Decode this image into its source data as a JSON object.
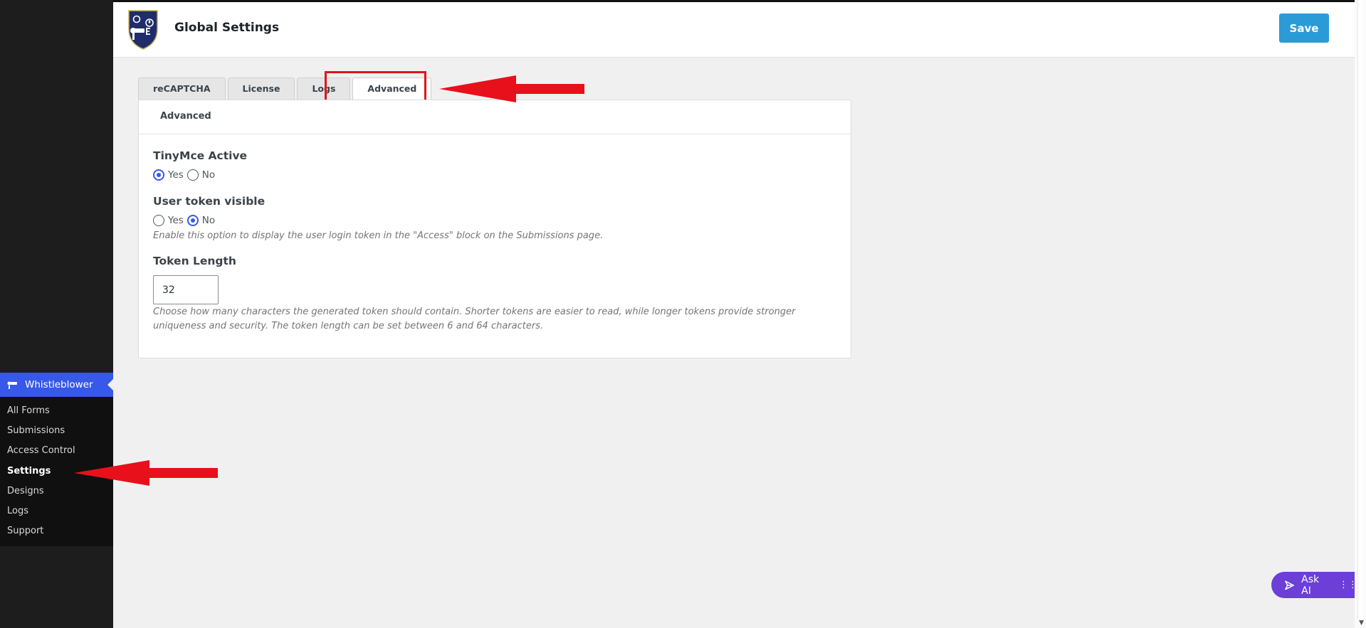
{
  "header": {
    "title": "Global Settings",
    "save_label": "Save"
  },
  "tabs": [
    {
      "label": "reCAPTCHA",
      "active": false
    },
    {
      "label": "License",
      "active": false
    },
    {
      "label": "Logs",
      "active": false
    },
    {
      "label": "Advanced",
      "active": true
    }
  ],
  "panel": {
    "heading": "Advanced",
    "tinymce": {
      "label": "TinyMce Active",
      "yes_label": "Yes",
      "no_label": "No",
      "selected": "Yes"
    },
    "user_token": {
      "label": "User token visible",
      "yes_label": "Yes",
      "no_label": "No",
      "selected": "No",
      "description": "Enable this option to display the user login token in the \"Access\" block on the Submissions page."
    },
    "token_length": {
      "label": "Token Length",
      "value": "32",
      "description": "Choose how many characters the generated token should contain. Shorter tokens are easier to read, while longer tokens provide stronger uniqueness and security. The token length can be set between 6 and 64 characters."
    }
  },
  "sidebar": {
    "parent_label": "Whistleblower",
    "items": [
      {
        "label": "All Forms",
        "active": false
      },
      {
        "label": "Submissions",
        "active": false
      },
      {
        "label": "Access Control",
        "active": false
      },
      {
        "label": "Settings",
        "active": true
      },
      {
        "label": "Designs",
        "active": false
      },
      {
        "label": "Logs",
        "active": false
      },
      {
        "label": "Support",
        "active": false
      }
    ]
  },
  "ask_ai": {
    "label": "Ask AI"
  },
  "colors": {
    "accent": "#3858e9",
    "save_button": "#2b9bd8",
    "annotation_red": "#e0141c",
    "ask_ai": "#6b3fd8"
  },
  "icons": [
    "whistleblower-logo",
    "whistle-icon",
    "sparkle-icon",
    "drag-handle-icon"
  ]
}
